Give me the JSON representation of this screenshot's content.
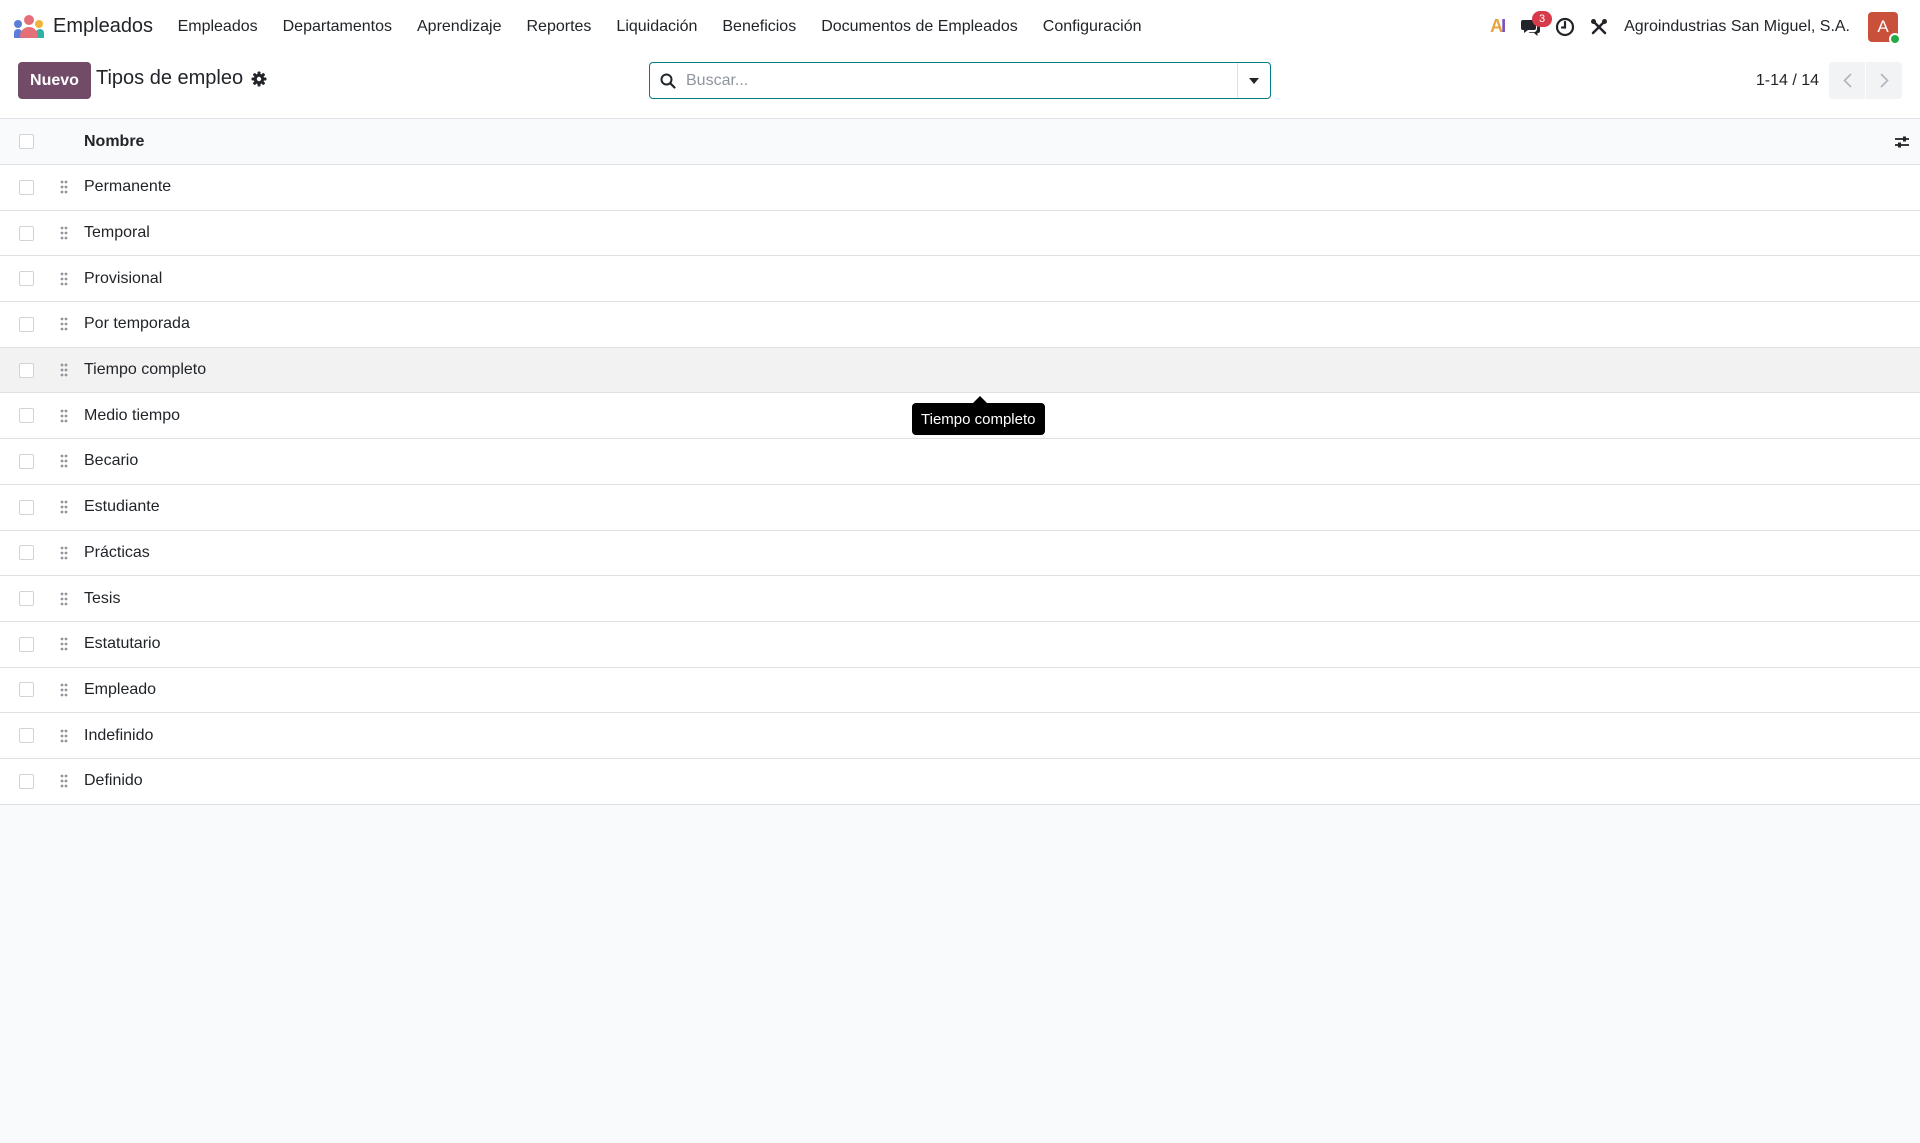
{
  "navbar": {
    "app_name": "Empleados",
    "menu": [
      {
        "label": "Empleados"
      },
      {
        "label": "Departamentos"
      },
      {
        "label": "Aprendizaje"
      },
      {
        "label": "Reportes"
      },
      {
        "label": "Liquidación"
      },
      {
        "label": "Beneficios"
      },
      {
        "label": "Documentos de Empleados"
      },
      {
        "label": "Configuración"
      }
    ],
    "ai_label": {
      "a": "A",
      "i": "I"
    },
    "messages_badge": "3",
    "company": "Agroindustrias San Miguel, S.A.",
    "avatar_letter": "A"
  },
  "control_panel": {
    "new_button": "Nuevo",
    "title": "Tipos de empleo",
    "search_placeholder": "Buscar...",
    "pager_value": "1-14 / 14"
  },
  "list": {
    "column_name": "Nombre",
    "rows": [
      {
        "name": "Permanente"
      },
      {
        "name": "Temporal"
      },
      {
        "name": "Provisional"
      },
      {
        "name": "Por temporada"
      },
      {
        "name": "Tiempo completo"
      },
      {
        "name": "Medio tiempo"
      },
      {
        "name": "Becario"
      },
      {
        "name": "Estudiante"
      },
      {
        "name": "Prácticas"
      },
      {
        "name": "Tesis"
      },
      {
        "name": "Estatutario"
      },
      {
        "name": "Empleado"
      },
      {
        "name": "Indefinido"
      },
      {
        "name": "Definido"
      }
    ]
  },
  "tooltip": {
    "text": "Tiempo completo"
  },
  "colors": {
    "primary": "#714b67",
    "search_border": "#017e84",
    "badge": "#d73a4a",
    "avatar": "#c9503a"
  }
}
